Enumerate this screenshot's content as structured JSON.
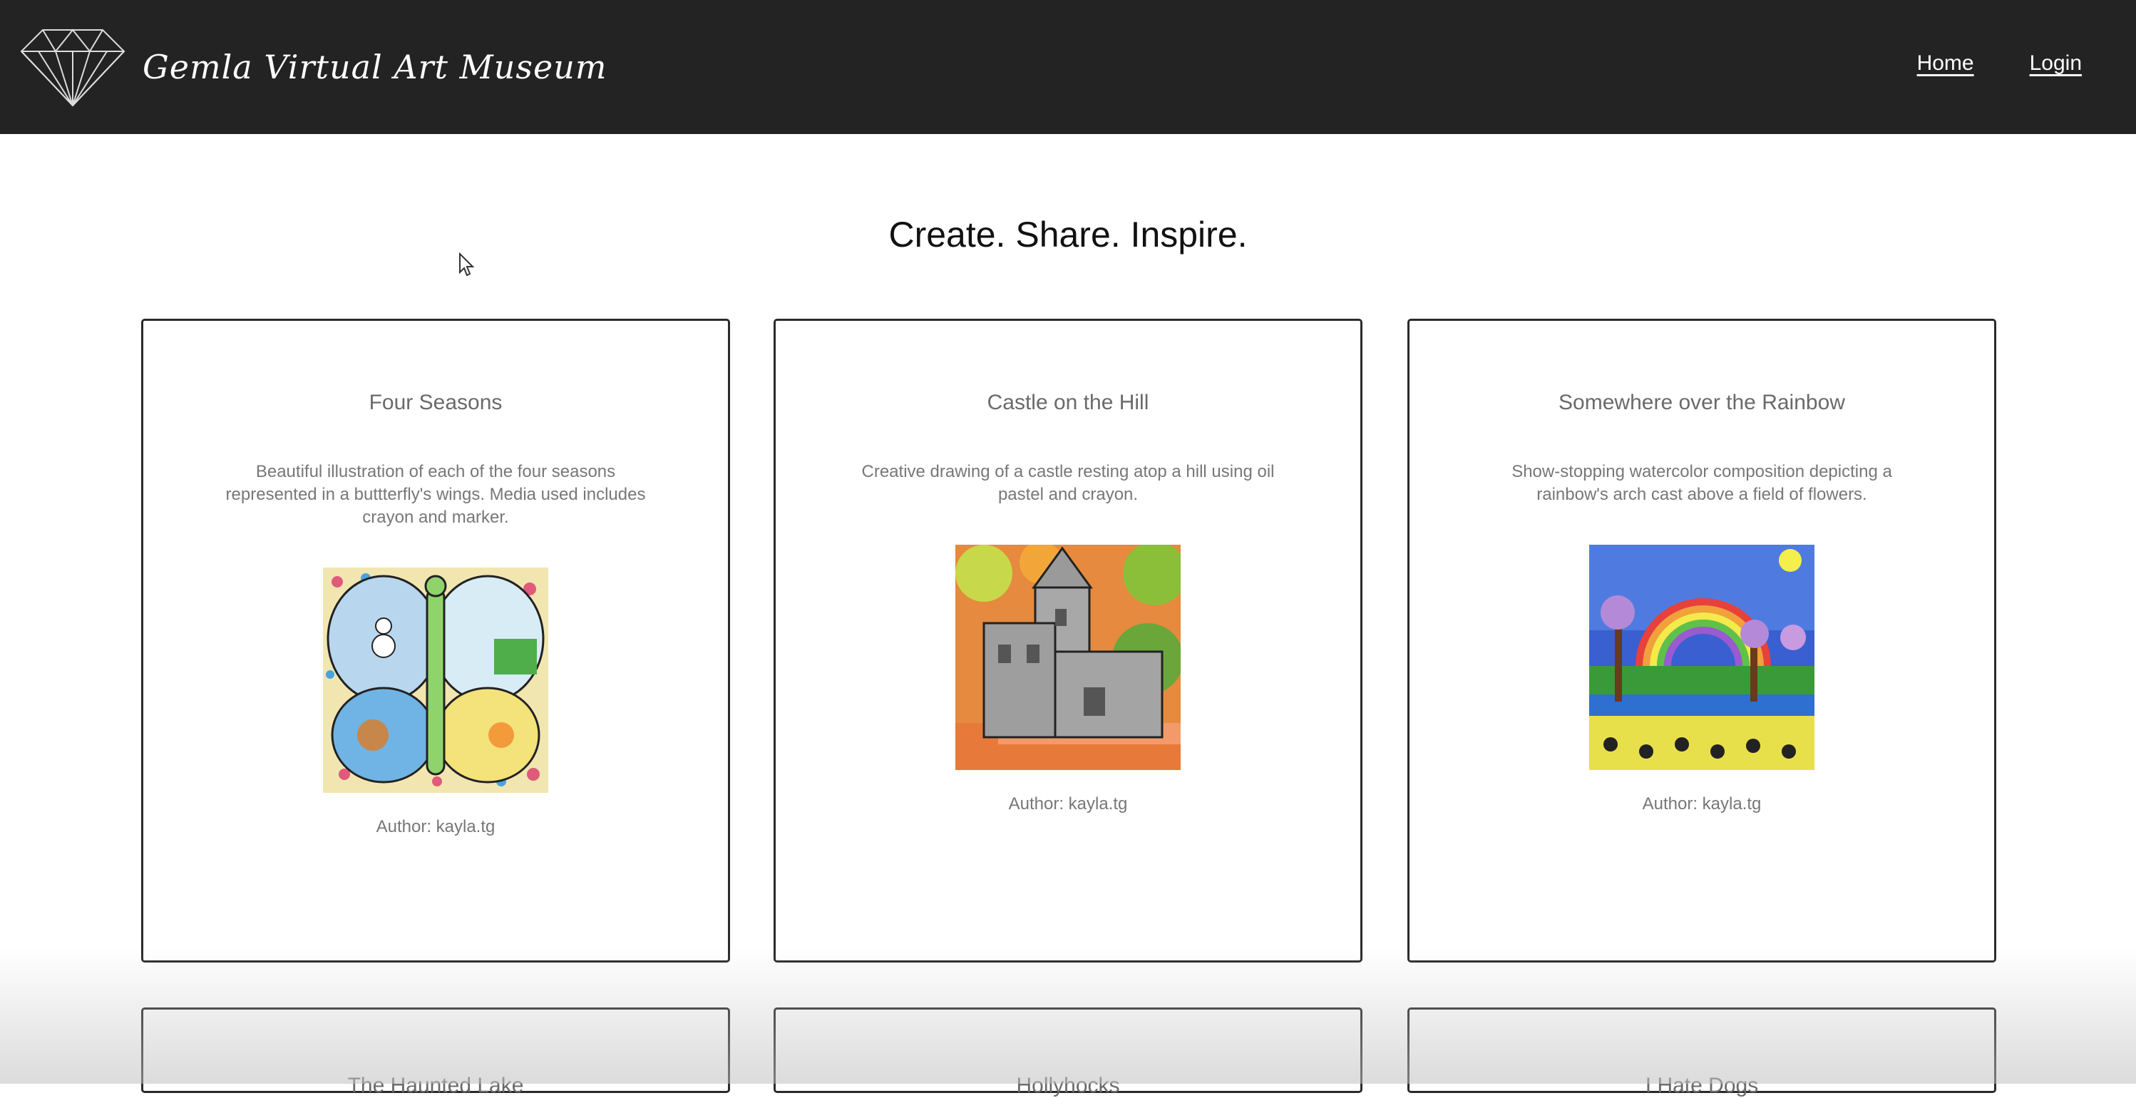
{
  "header": {
    "site_title": "Gemla Virtual Art Museum",
    "logo_icon": "diamond-icon",
    "nav": {
      "home": "Home",
      "login": "Login"
    }
  },
  "hero": {
    "heading": "Create. Share. Inspire."
  },
  "artworks": [
    {
      "title": "Four Seasons",
      "description": "Beautiful illustration of each of the four seasons represented in a buttterfly's wings. Media used includes crayon and marker.",
      "author": "Author: kayla.tg"
    },
    {
      "title": "Castle on the Hill",
      "description": "Creative drawing of a castle resting atop a hill using oil pastel and crayon.",
      "author": "Author: kayla.tg"
    },
    {
      "title": "Somewhere over the Rainbow",
      "description": "Show-stopping watercolor composition depicting a rainbow's arch cast above a field of flowers.",
      "author": "Author: kayla.tg"
    }
  ],
  "partial_cards": [
    {
      "title": "The Haunted Lake"
    },
    {
      "title": "Hollyhocks"
    },
    {
      "title": "I Hate Dogs"
    }
  ],
  "colors": {
    "navbar": "#232323",
    "card_border": "#2a2a2a",
    "text_muted": "#777777"
  }
}
